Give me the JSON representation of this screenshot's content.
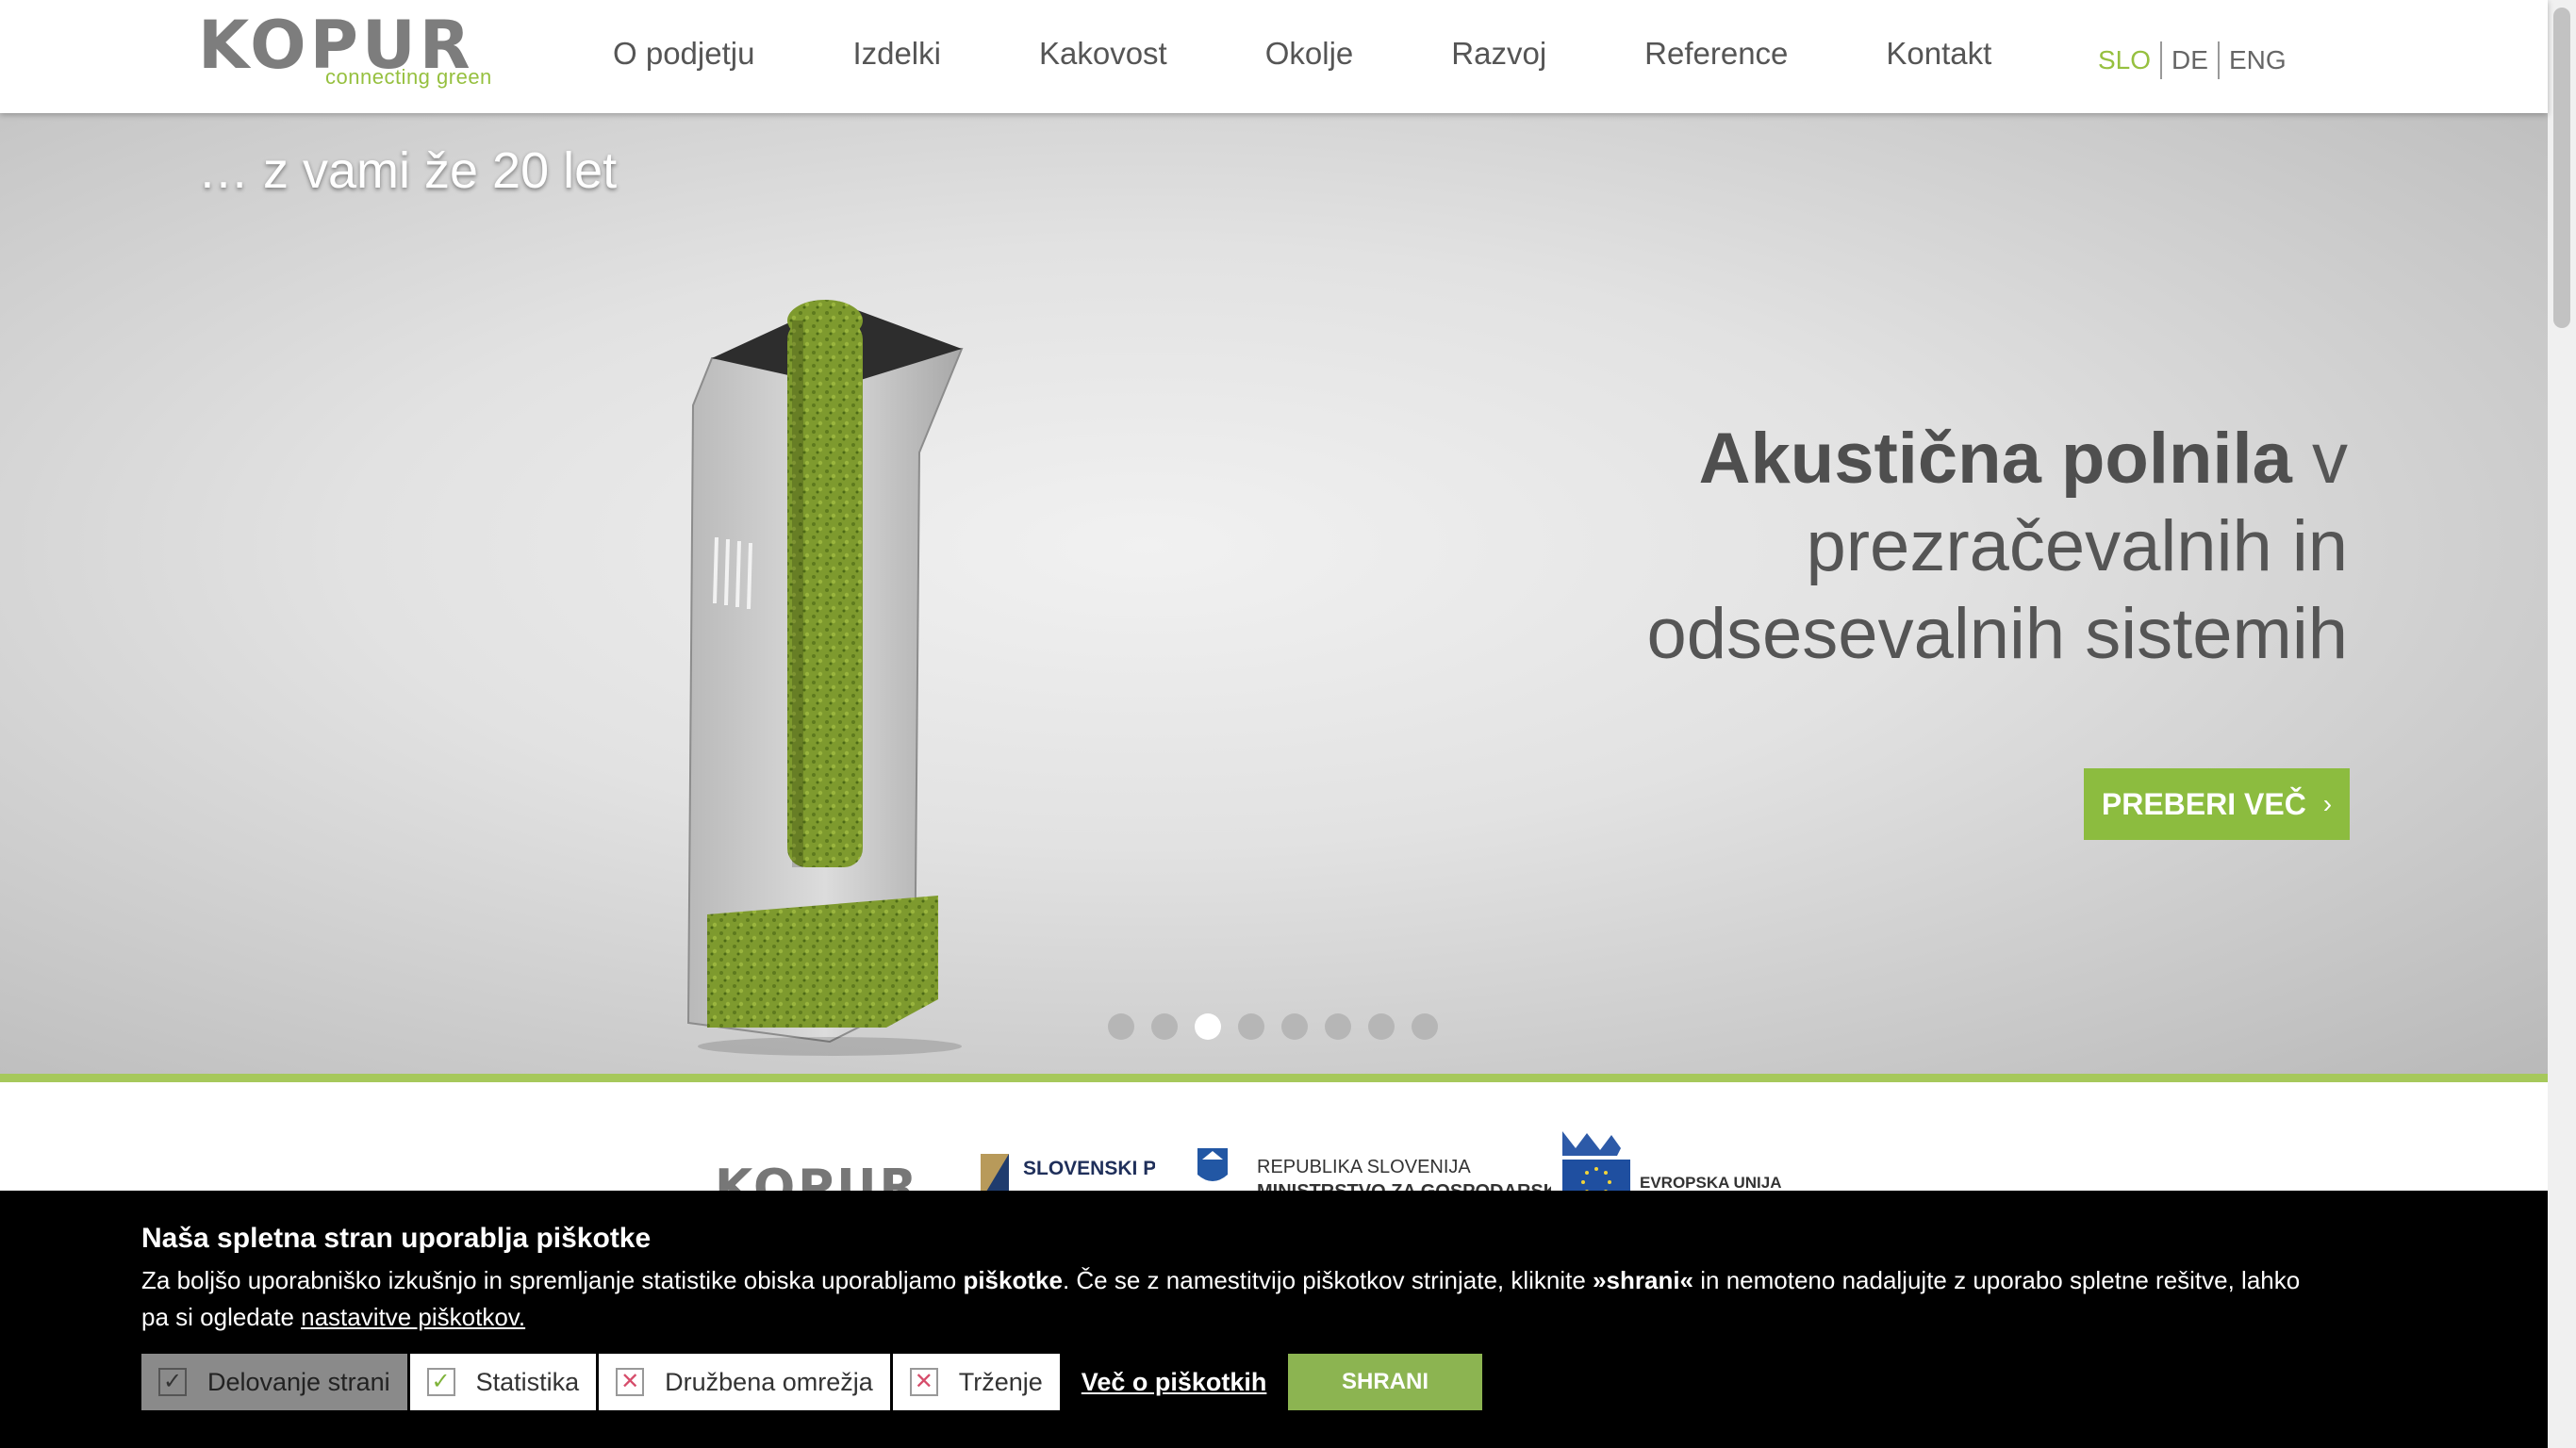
{
  "header": {
    "logo": {
      "word": "KOPUR",
      "tagline": "connecting green"
    },
    "nav": [
      "O podjetju",
      "Izdelki",
      "Kakovost",
      "Okolje",
      "Razvoj",
      "Reference",
      "Kontakt"
    ],
    "languages": [
      {
        "label": "SLO",
        "active": true
      },
      {
        "label": "DE",
        "active": false
      },
      {
        "label": "ENG",
        "active": false
      }
    ]
  },
  "hero": {
    "tagline": "… z vami že 20 let",
    "title_bold": "Akustična polnila",
    "title_rest_1": "v",
    "title_rest_2": "prezračevalnih in",
    "title_rest_3": "odsesevalnih sistemih",
    "cta_label": "PREBERI VEČ",
    "cta_icon": "chevron-right-icon",
    "slide_count": 8,
    "active_slide": 3
  },
  "partners": {
    "kopur": "KOPUR",
    "sps": "SLOVENSKI PODJETNIŠKI",
    "rs_line1": "REPUBLIKA SLOVENIJA",
    "rs_line2": "MINISTRSTVO ZA GOSPODARSKI",
    "eu": "EVROPSKA UNIJA"
  },
  "cookie": {
    "title": "Naša spletna stran uporablja piškotke",
    "text_1": "Za boljšo uporabniško izkušnjo in spremljanje statistike obiska uporabljamo ",
    "text_bold_1": "piškotke",
    "text_2": ". Če se z namestitvijo piškotkov strinjate, kliknite ",
    "text_bold_2": "»shrani«",
    "text_3": " in nemoteno nadaljujte z uporabo spletne rešitve, lahko pa si ogledate ",
    "settings_link": "nastavitve piškotkov.",
    "options": [
      {
        "label": "Delovanje strani",
        "state": "on",
        "disabled": true
      },
      {
        "label": "Statistika",
        "state": "on",
        "disabled": false
      },
      {
        "label": "Družbena omrežja",
        "state": "off",
        "disabled": false
      },
      {
        "label": "Trženje",
        "state": "off",
        "disabled": false
      }
    ],
    "more_link": "Več o piškotkih",
    "save_label": "SHRANI"
  },
  "colors": {
    "accent": "#8cbc3f",
    "text": "#555555",
    "cookie_bg": "#000000"
  }
}
